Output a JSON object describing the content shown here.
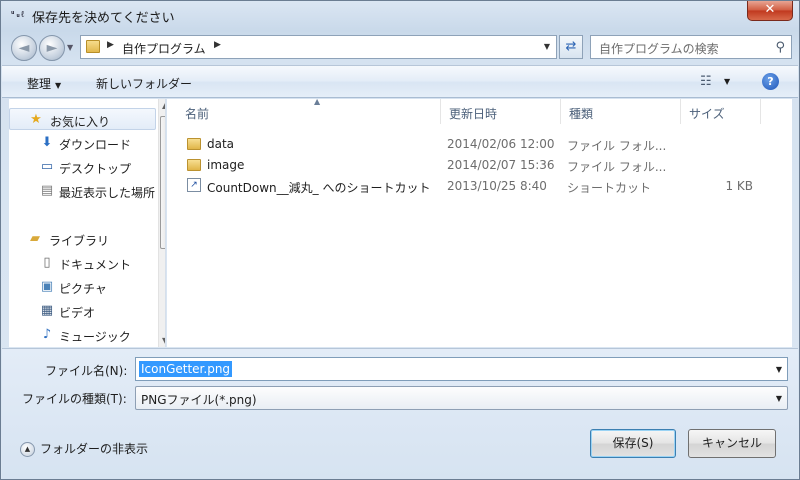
{
  "window": {
    "title": "保存先を決めてください",
    "app_icon_text": "ᵘᵤℓ",
    "close_label": "✕"
  },
  "nav": {
    "back_glyph": "◄",
    "forward_glyph": "►",
    "address_path": "自作プログラム",
    "search_placeholder": "自作プログラムの検索"
  },
  "toolbar": {
    "organize_label": "整理",
    "new_folder_label": "新しいフォルダー",
    "help_label": "?"
  },
  "navpane": {
    "items": [
      {
        "label": "お気に入り",
        "icon": "star-icon",
        "glyph": "★",
        "color": "#e5a91d"
      },
      {
        "label": "ダウンロード",
        "icon": "downloads-folder-icon",
        "glyph": "⬇",
        "color": "#2b6fc4"
      },
      {
        "label": "デスクトップ",
        "icon": "desktop-icon",
        "glyph": "▭",
        "color": "#3466a8"
      },
      {
        "label": "最近表示した場所",
        "icon": "recent-places-icon",
        "glyph": "▤",
        "color": "#7a7a7a"
      },
      {
        "label": "ライブラリ",
        "icon": "libraries-icon",
        "glyph": "▰",
        "color": "#d9a93a"
      },
      {
        "label": "ドキュメント",
        "icon": "documents-icon",
        "glyph": "▯",
        "color": "#6d6d6d"
      },
      {
        "label": "ピクチャ",
        "icon": "pictures-icon",
        "glyph": "▣",
        "color": "#4a82b8"
      },
      {
        "label": "ビデオ",
        "icon": "videos-icon",
        "glyph": "▦",
        "color": "#3b5a80"
      },
      {
        "label": "ミュージック",
        "icon": "music-icon",
        "glyph": "♪",
        "color": "#2f6fc0"
      }
    ]
  },
  "filelist": {
    "columns": [
      "名前",
      "更新日時",
      "種類",
      "サイズ"
    ],
    "rows": [
      {
        "name": "data",
        "date": "2014/02/06 12:00",
        "type": "ファイル フォル...",
        "size": "",
        "kind": "folder"
      },
      {
        "name": "image",
        "date": "2014/02/07 15:36",
        "type": "ファイル フォル...",
        "size": "",
        "kind": "folder"
      },
      {
        "name": "CountDown__減丸_ へのショートカット",
        "date": "2013/10/25 8:40",
        "type": "ショートカット",
        "size": "1 KB",
        "kind": "shortcut"
      }
    ]
  },
  "form": {
    "filename_label": "ファイル名(N):",
    "filename_value": "IconGetter.png",
    "filetype_label": "ファイルの種類(T):",
    "filetype_value": "PNGファイル(*.png)",
    "hide_folders_label": "フォルダーの非表示",
    "save_label": "保存(S)",
    "cancel_label": "キャンセル"
  }
}
